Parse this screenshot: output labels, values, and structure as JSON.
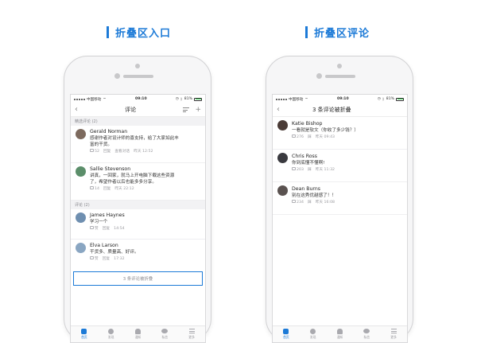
{
  "headings": {
    "left": "折叠区入口",
    "right": "折叠区评论"
  },
  "colors": {
    "accent": "#1c7ad7"
  },
  "left_phone": {
    "status": {
      "carrier": "中国移动",
      "time": "09:10",
      "battery": "81%"
    },
    "nav": {
      "back_icon": "chevron-left-icon",
      "title": "评论",
      "sort_icon": "sort-icon",
      "add_icon": "plus-icon"
    },
    "featured_header": "精选评论 (2)",
    "featured": [
      {
        "name": "Gerald Norman",
        "text1": "感谢作者对设计师的喜支持，给了大家如此丰",
        "text2": "富的干货。",
        "likes": "52",
        "reply": "回复",
        "thread": "查看对话",
        "time": "昨天 12:52",
        "avatar_color": "#7d6a5e"
      },
      {
        "name": "Sallie Stevenson",
        "text1": "讲真，一回家，就马上开电脑下载这些资源",
        "text2": "了，希望作者以后也能多多分享。",
        "likes": "14",
        "reply": "回复",
        "thread": "",
        "time": "昨天 22:12",
        "avatar_color": "#5b8e6a"
      }
    ],
    "comments_header": "评论 (2)",
    "comments": [
      {
        "name": "James Haynes",
        "text1": "学习一个",
        "likes": "赞",
        "reply": "回复",
        "time": "14:54",
        "avatar_color": "#6f8fb0"
      },
      {
        "name": "Elva Larson",
        "text1": "干货多、质量高、好评。",
        "likes": "赞",
        "reply": "回复",
        "time": "17:32",
        "avatar_color": "#8aa6c2"
      }
    ],
    "fold_entry": "3 条评论被折叠",
    "tabs": [
      {
        "label": "首页",
        "icon": "home-icon"
      },
      {
        "label": "发现",
        "icon": "compass-icon"
      },
      {
        "label": "通知",
        "icon": "bell-icon"
      },
      {
        "label": "私信",
        "icon": "message-icon"
      },
      {
        "label": "更多",
        "icon": "menu-icon"
      }
    ]
  },
  "right_phone": {
    "status": {
      "carrier": "中国移动",
      "time": "09:10",
      "battery": "81%"
    },
    "nav": {
      "back_icon": "chevron-left-icon",
      "title": "3 条评论被折叠"
    },
    "comments": [
      {
        "name": "Katie Bishop",
        "text1": "一看就是软文（你收了多少钱？）",
        "likes": "276",
        "dislike": "踩",
        "time": "昨天 09:43",
        "avatar_color": "#4a3b36"
      },
      {
        "name": "Chris Ross",
        "text1": "你到底懂不懂啊!",
        "likes": "203",
        "dislike": "踩",
        "time": "昨天 11:32",
        "avatar_color": "#3a3a3f"
      },
      {
        "name": "Dean Burns",
        "text1": "别在这秀优越感了！！",
        "likes": "234",
        "dislike": "踩",
        "time": "昨天 16:08",
        "avatar_color": "#5a5250"
      }
    ],
    "tabs": [
      {
        "label": "首页",
        "icon": "home-icon"
      },
      {
        "label": "发现",
        "icon": "compass-icon"
      },
      {
        "label": "通知",
        "icon": "bell-icon"
      },
      {
        "label": "私信",
        "icon": "message-icon"
      },
      {
        "label": "更多",
        "icon": "menu-icon"
      }
    ]
  }
}
